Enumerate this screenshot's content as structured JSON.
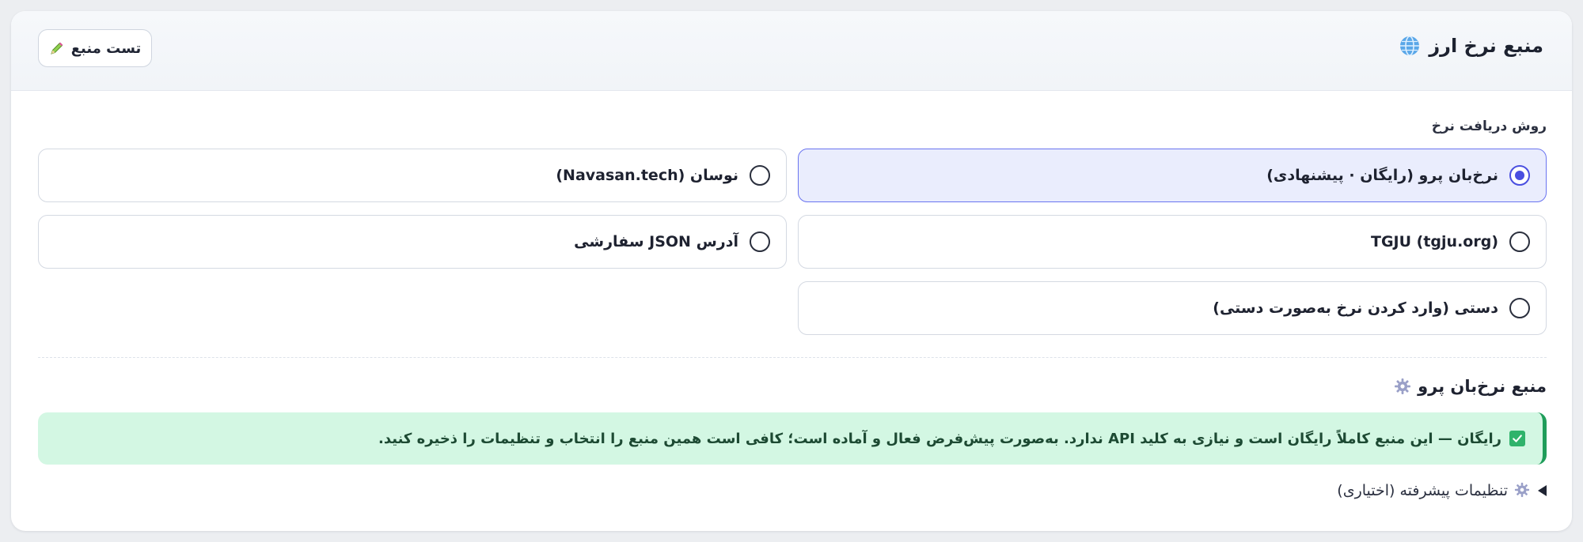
{
  "header": {
    "title": "منبع نرخ ارز",
    "title_icon": "globe-icon",
    "test_button": {
      "label": "تست منبع",
      "icon": "pencil-icon"
    }
  },
  "rate_method": {
    "label": "روش دریافت نرخ",
    "options": [
      {
        "label": "نرخ‌بان پرو (رایگان · پیشنهادی)",
        "selected": true
      },
      {
        "label": "نوسان (Navasan.tech)",
        "selected": false
      },
      {
        "label": "TGJU (tgju.org)",
        "selected": false
      },
      {
        "label": "آدرس JSON سفارشی",
        "selected": false
      },
      {
        "label": "دستی (وارد کردن نرخ به‌صورت دستی)",
        "selected": false
      }
    ]
  },
  "source_section": {
    "title": "منبع نرخ‌بان پرو",
    "icon": "gear-icon",
    "notice": "رایگان — این منبع کاملاً رایگان است و نیازی به کلید API ندارد. به‌صورت پیش‌فرض فعال و آماده است؛ کافی است همین منبع را انتخاب و تنظیمات را ذخیره کنید."
  },
  "advanced": {
    "label": "تنظیمات پیشرفته (اختیاری)",
    "expanded": false
  },
  "colors": {
    "accent": "#4a4fe0",
    "selected_bg": "#eaedfd",
    "success_bg": "#d3f7e3",
    "success_border": "#1f9d5a"
  }
}
